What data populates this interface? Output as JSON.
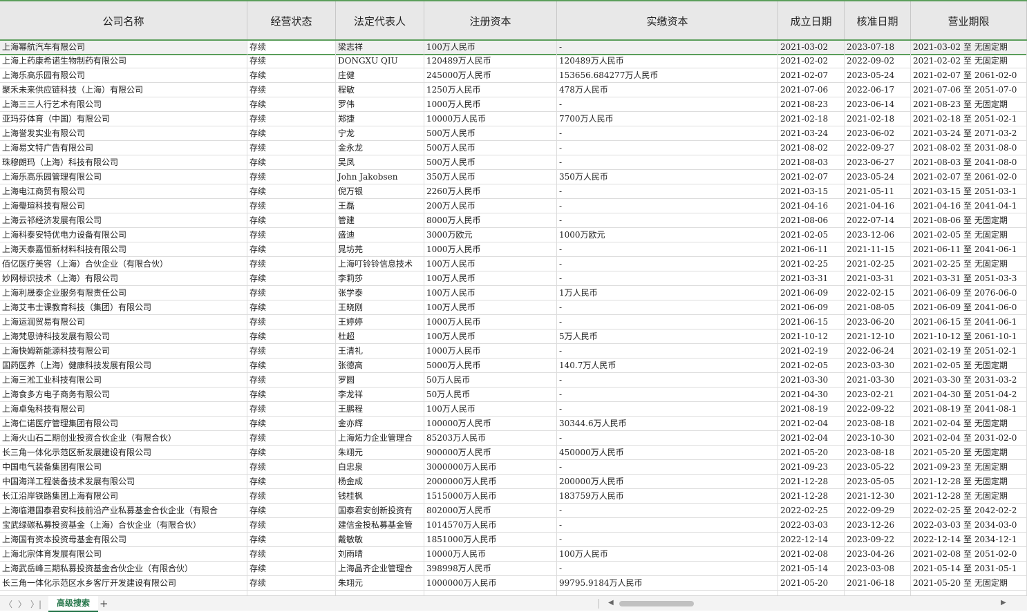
{
  "columns": [
    "公司名称",
    "经营状态",
    "法定代表人",
    "注册资本",
    "实缴资本",
    "成立日期",
    "核准日期",
    "营业期限"
  ],
  "rows": [
    [
      "上海幂航汽车有限公司",
      "存续",
      "梁志祥",
      "100万人民币",
      "-",
      "2021-03-02",
      "2023-07-18",
      "2021-03-02  至 无固定期"
    ],
    [
      "上海上药康希诺生物制药有限公司",
      "存续",
      "DONGXU QIU",
      "120489万人民币",
      "120489万人民币",
      "2021-02-02",
      "2022-09-02",
      "2021-02-02  至 无固定期"
    ],
    [
      "上海乐高乐园有限公司",
      "存续",
      "庄健",
      "245000万人民币",
      "153656.684277万人民币",
      "2021-02-07",
      "2023-05-24",
      "2021-02-07  至 2061-02-0"
    ],
    [
      "聚禾未来供应链科技（上海）有限公司",
      "存续",
      "程敏",
      "1250万人民币",
      "478万人民币",
      "2021-07-06",
      "2022-06-17",
      "2021-07-06  至 2051-07-0"
    ],
    [
      "上海三三人行艺术有限公司",
      "存续",
      "罗伟",
      "1000万人民币",
      "-",
      "2021-08-23",
      "2023-06-14",
      "2021-08-23  至 无固定期"
    ],
    [
      "亚玛芬体育（中国）有限公司",
      "存续",
      "郑捷",
      "10000万人民币",
      "7700万人民币",
      "2021-02-18",
      "2021-02-18",
      "2021-02-18  至 2051-02-1"
    ],
    [
      "上海誉发实业有限公司",
      "存续",
      "宁龙",
      "500万人民币",
      "-",
      "2021-03-24",
      "2023-06-02",
      "2021-03-24  至 2071-03-2"
    ],
    [
      "上海易文特广告有限公司",
      "存续",
      "金永龙",
      "500万人民币",
      "-",
      "2021-08-02",
      "2022-09-27",
      "2021-08-02  至 2031-08-0"
    ],
    [
      "珠穆朗玛（上海）科技有限公司",
      "存续",
      "吴凤",
      "500万人民币",
      "-",
      "2021-08-03",
      "2023-06-27",
      "2021-08-03  至 2041-08-0"
    ],
    [
      "上海乐高乐园管理有限公司",
      "存续",
      "John Jakobsen",
      "350万人民币",
      "350万人民币",
      "2021-02-07",
      "2023-05-24",
      "2021-02-07  至 2061-02-0"
    ],
    [
      "上海电江商贸有限公司",
      "存续",
      "倪万银",
      "2260万人民币",
      "-",
      "2021-03-15",
      "2021-05-11",
      "2021-03-15  至 2051-03-1"
    ],
    [
      "上海璺瑄科技有限公司",
      "存续",
      "王磊",
      "200万人民币",
      "-",
      "2021-04-16",
      "2021-04-16",
      "2021-04-16  至 2041-04-1"
    ],
    [
      "上海云祁经济发展有限公司",
      "存续",
      "管建",
      "8000万人民币",
      "-",
      "2021-08-06",
      "2022-07-14",
      "2021-08-06  至 无固定期"
    ],
    [
      "上海科泰安特优电力设备有限公司",
      "存续",
      "盛迪",
      "3000万欧元",
      "1000万欧元",
      "2021-02-05",
      "2023-12-06",
      "2021-02-05  至 无固定期"
    ],
    [
      "上海天泰嘉恒新材料科技有限公司",
      "存续",
      "晁坊芫",
      "1000万人民币",
      "-",
      "2021-06-11",
      "2021-11-15",
      "2021-06-11  至 2041-06-1"
    ],
    [
      "佰亿医疗美容（上海）合伙企业（有限合伙）",
      "存续",
      "上海叮铃铃信息技术",
      "100万人民币",
      "-",
      "2021-02-25",
      "2021-02-25",
      "2021-02-25  至 无固定期"
    ],
    [
      "妙网标识技术（上海）有限公司",
      "存续",
      "李莉莎",
      "100万人民币",
      "-",
      "2021-03-31",
      "2021-03-31",
      "2021-03-31  至 2051-03-3"
    ],
    [
      "上海利晟泰企业服务有限责任公司",
      "存续",
      "张学泰",
      "100万人民币",
      "1万人民币",
      "2021-06-09",
      "2022-02-15",
      "2021-06-09  至 2076-06-0"
    ],
    [
      "上海艾韦士课教育科技（集团）有限公司",
      "存续",
      "王晓刚",
      "100万人民币",
      "-",
      "2021-06-09",
      "2021-08-05",
      "2021-06-09  至 2041-06-0"
    ],
    [
      "上海运润贸易有限公司",
      "存续",
      "王婷婷",
      "1000万人民币",
      "-",
      "2021-06-15",
      "2023-06-20",
      "2021-06-15  至 2041-06-1"
    ],
    [
      "上海梵恩诗科技发展有限公司",
      "存续",
      "杜超",
      "100万人民币",
      "5万人民币",
      "2021-10-12",
      "2021-12-10",
      "2021-10-12  至 2061-10-1"
    ],
    [
      "上海快姆新能源科技有限公司",
      "存续",
      "王清礼",
      "1000万人民币",
      "-",
      "2021-02-19",
      "2022-06-24",
      "2021-02-19  至 2051-02-1"
    ],
    [
      "国药医养（上海）健康科技发展有限公司",
      "存续",
      "张德高",
      "5000万人民币",
      "140.7万人民币",
      "2021-02-05",
      "2023-03-30",
      "2021-02-05  至 无固定期"
    ],
    [
      "上海三淞工业科技有限公司",
      "存续",
      "罗圆",
      "50万人民币",
      "-",
      "2021-03-30",
      "2021-03-30",
      "2021-03-30  至 2031-03-2"
    ],
    [
      "上海食多方电子商务有限公司",
      "存续",
      "李龙祥",
      "50万人民币",
      "-",
      "2021-04-30",
      "2023-02-21",
      "2021-04-30  至 2051-04-2"
    ],
    [
      "上海卓兔科技有限公司",
      "存续",
      "王鹏程",
      "100万人民币",
      "-",
      "2021-08-19",
      "2022-09-22",
      "2021-08-19  至 2041-08-1"
    ],
    [
      "上海仁诺医疗管理集团有限公司",
      "存续",
      "金亦辉",
      "100000万人民币",
      "30344.6万人民币",
      "2021-02-04",
      "2023-08-18",
      "2021-02-04  至 无固定期"
    ],
    [
      "上海火山石二期创业投资合伙企业（有限合伙）",
      "存续",
      "上海炻力企业管理合",
      "85203万人民币",
      "-",
      "2021-02-04",
      "2023-10-30",
      "2021-02-04  至 2031-02-0"
    ],
    [
      "长三角一体化示范区新发展建设有限公司",
      "存续",
      "朱翊元",
      "900000万人民币",
      "450000万人民币",
      "2021-05-20",
      "2023-08-18",
      "2021-05-20  至 无固定期"
    ],
    [
      "中国电气装备集团有限公司",
      "存续",
      "白忠泉",
      "3000000万人民币",
      "-",
      "2021-09-23",
      "2023-05-22",
      "2021-09-23  至 无固定期"
    ],
    [
      "中国海洋工程装备技术发展有限公司",
      "存续",
      "杨金成",
      "2000000万人民币",
      "200000万人民币",
      "2021-12-28",
      "2023-05-05",
      "2021-12-28  至 无固定期"
    ],
    [
      "长江沿岸铁路集团上海有限公司",
      "存续",
      "钱桂枫",
      "1515000万人民币",
      "183759万人民币",
      "2021-12-28",
      "2021-12-30",
      "2021-12-28  至 无固定期"
    ],
    [
      "上海临港国泰君安科技前沿产业私募基金合伙企业（有限合",
      "存续",
      "国泰君安创新投资有",
      "802000万人民币",
      "-",
      "2022-02-25",
      "2022-09-29",
      "2022-02-25  至 2042-02-2"
    ],
    [
      "宝武绿碳私募投资基金（上海）合伙企业（有限合伙）",
      "存续",
      "建信金投私募基金管",
      "1014570万人民币",
      "-",
      "2022-03-03",
      "2023-12-26",
      "2022-03-03  至 2034-03-0"
    ],
    [
      "上海国有资本投资母基金有限公司",
      "存续",
      "戴敏敏",
      "1851000万人民币",
      "-",
      "2022-12-14",
      "2023-09-22",
      "2022-12-14  至 2034-12-1"
    ],
    [
      "上海北宗体育发展有限公司",
      "存续",
      "刘雨晴",
      "10000万人民币",
      "100万人民币",
      "2021-02-08",
      "2023-04-26",
      "2021-02-08  至 2051-02-0"
    ],
    [
      "上海武岳峰三期私募投资基金合伙企业（有限合伙）",
      "存续",
      "上海晶齐企业管理合",
      "398998万人民币",
      "-",
      "2021-05-14",
      "2023-03-08",
      "2021-05-14  至 2031-05-1"
    ],
    [
      "长三角一体化示范区水乡客厅开发建设有限公司",
      "存续",
      "朱翊元",
      "1000000万人民币",
      "99795.9184万人民币",
      "2021-05-20",
      "2021-06-18",
      "2021-05-20  至 无固定期"
    ],
    [
      "",
      "",
      "",
      "",
      "",
      "",
      "",
      ""
    ]
  ],
  "footer": {
    "nav_prev_all": "〈",
    "nav_prev": "〈",
    "nav_next": "〉",
    "nav_last": "〉|",
    "sheet_tab": "高级搜索",
    "add_sheet": "+"
  }
}
